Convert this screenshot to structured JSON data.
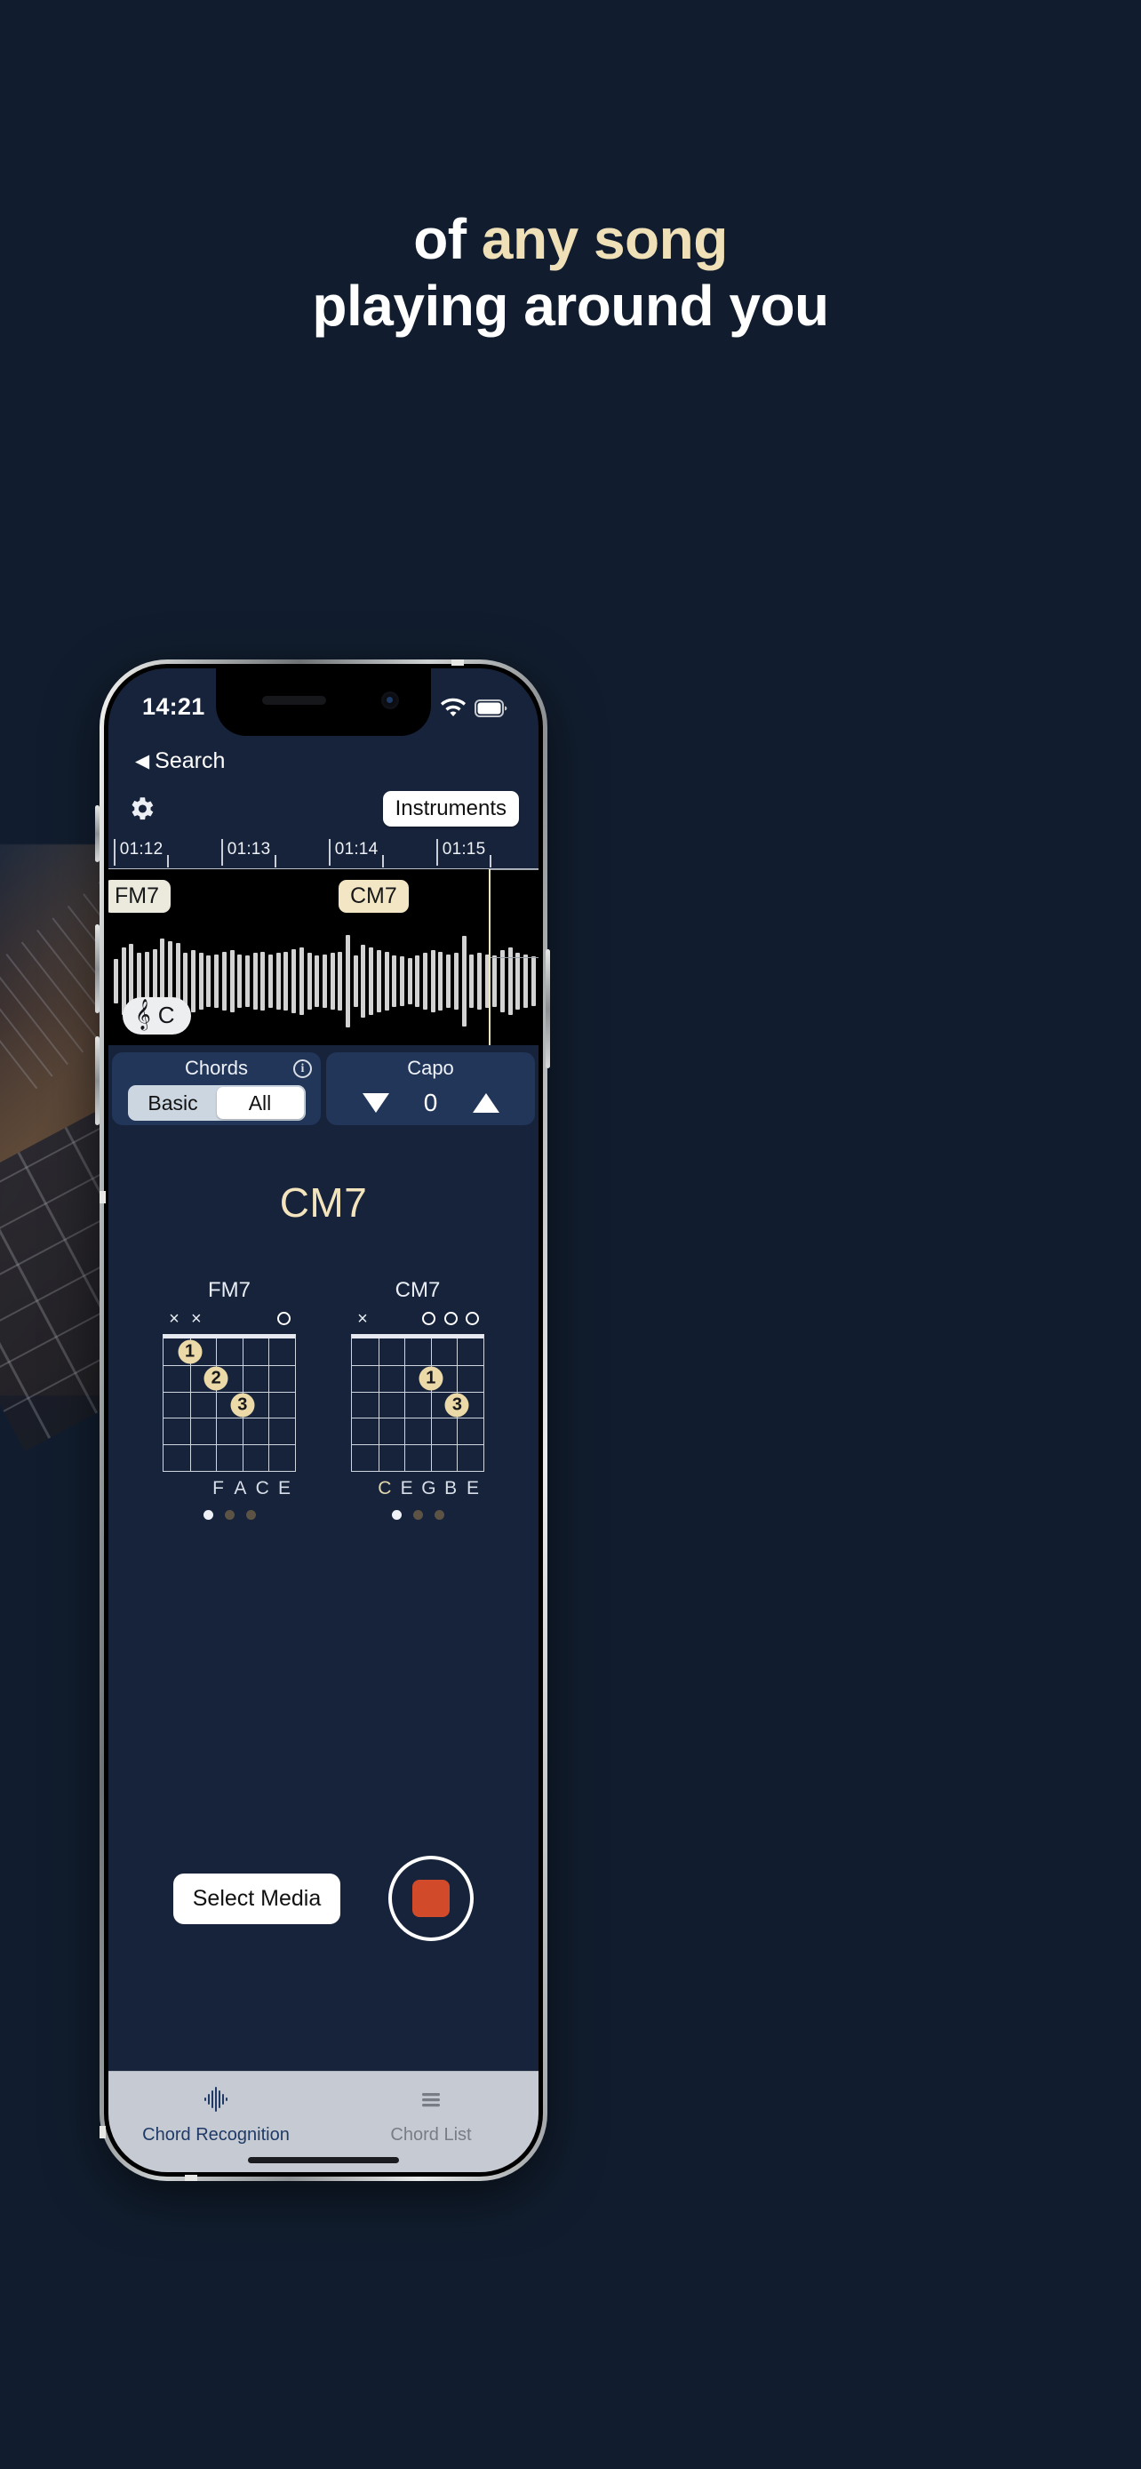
{
  "headline": {
    "line1_prefix": "of ",
    "line1_accent": "any song",
    "line2": "playing around you",
    "accent_color": "#f0e0b8"
  },
  "phone": {
    "statusbar": {
      "time": "14:21",
      "recording_indicator": "recording-dot",
      "icons": [
        "airplane-mode-icon",
        "wifi-icon",
        "battery-icon"
      ]
    },
    "back": {
      "caret": "◀",
      "label": "Search"
    }
  },
  "toolbar": {
    "settings_icon": "gear-icon",
    "instruments_label": "Instruments"
  },
  "timeline": {
    "labels": [
      "01:12",
      "01:13",
      "01:14",
      "01:15"
    ]
  },
  "waveform": {
    "chord_tags": [
      {
        "label": "FM7",
        "left_pct": -1,
        "dim": true
      },
      {
        "label": "CM7",
        "left_pct": 53.5,
        "dim": false
      }
    ],
    "key_badge": {
      "clef": "𝄞",
      "key": "C"
    },
    "playhead_pct": 88.5
  },
  "controls": {
    "chords": {
      "title": "Chords",
      "info_icon": "info-icon",
      "options": [
        "Basic",
        "All"
      ],
      "selected": "All"
    },
    "capo": {
      "title": "Capo",
      "decrement_icon": "triangle-down-icon",
      "increment_icon": "triangle-up-icon",
      "value": "0"
    }
  },
  "main": {
    "current_chord": "CM7",
    "diagrams": [
      {
        "name": "FM7",
        "markers": [
          "x",
          "x",
          "",
          "",
          "",
          "o"
        ],
        "fingers": [
          {
            "string": 5,
            "fret": 1,
            "finger": "1"
          },
          {
            "string": 4,
            "fret": 2,
            "finger": "2"
          },
          {
            "string": 3,
            "fret": 3,
            "finger": "3"
          }
        ],
        "notes": [
          "",
          "",
          "F",
          "A",
          "C",
          "E"
        ],
        "pages": 3,
        "active_page": 0
      },
      {
        "name": "CM7",
        "markers": [
          "x",
          "",
          "",
          "o",
          "o",
          "o"
        ],
        "fingers": [
          {
            "string": 3,
            "fret": 2,
            "finger": "1"
          },
          {
            "string": 2,
            "fret": 3,
            "finger": "3"
          }
        ],
        "notes": [
          "",
          "C",
          "E",
          "G",
          "B",
          "E"
        ],
        "pages": 3,
        "active_page": 0
      }
    ]
  },
  "actions": {
    "select_media_label": "Select Media",
    "record_button": "stop-recording-button"
  },
  "tabbar": {
    "tabs": [
      {
        "label": "Chord Recognition",
        "icon": "waveform-icon",
        "active": true
      },
      {
        "label": "Chord List",
        "icon": "list-icon",
        "active": false
      }
    ]
  }
}
